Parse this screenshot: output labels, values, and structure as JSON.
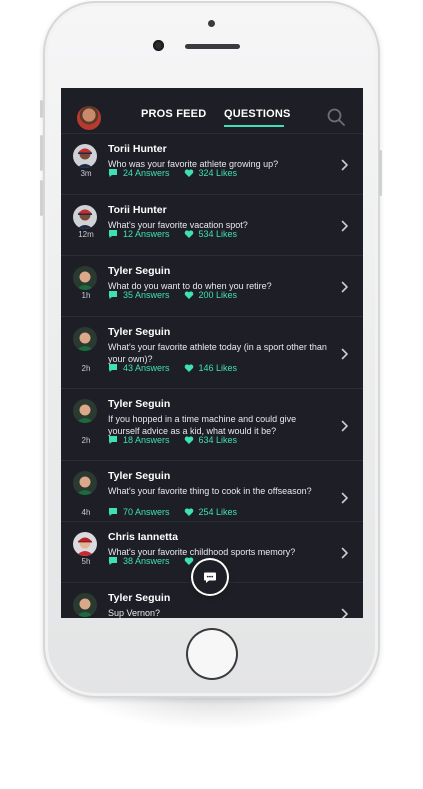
{
  "header": {
    "tabs": [
      {
        "label": "PROS FEED",
        "active": false
      },
      {
        "label": "QUESTIONS",
        "active": true
      }
    ]
  },
  "colors": {
    "accent": "#3ee0b5",
    "background": "#1e1f26",
    "divider": "#2b2c35"
  },
  "questions": [
    {
      "name": "Torii Hunter",
      "question": "Who was your favorite athlete growing up?",
      "time": "3m",
      "answers": "24 Answers",
      "likes": "324 Likes",
      "avatar": "torii"
    },
    {
      "name": "Torii Hunter",
      "question": "What's your favorite vacation spot?",
      "time": "12m",
      "answers": "12 Answers",
      "likes": "534 Likes",
      "avatar": "torii"
    },
    {
      "name": "Tyler Seguin",
      "question": "What do you want to do when you retire?",
      "time": "1h",
      "answers": "35 Answers",
      "likes": "200 Likes",
      "avatar": "tyler"
    },
    {
      "name": "Tyler Seguin",
      "question": "What's your favorite athlete today (in a sport other than your own)?",
      "time": "2h",
      "answers": "43 Answers",
      "likes": "146 Likes",
      "avatar": "tyler"
    },
    {
      "name": "Tyler Seguin",
      "question": "If you hopped in a time machine and could give yourself advice as a kid, what would it be?",
      "time": "2h",
      "answers": "18 Answers",
      "likes": "634 Likes",
      "avatar": "tyler"
    },
    {
      "name": "Tyler Seguin",
      "question": "What's your favorite thing to cook in the offseason?",
      "time": "4h",
      "answers": "70 Answers",
      "likes": "254 Likes",
      "avatar": "tyler"
    },
    {
      "name": "Chris Iannetta",
      "question": "What's your favorite childhood sports memory?",
      "time": "5h",
      "answers": "38 Answers",
      "likes": "",
      "avatar": "chris"
    },
    {
      "name": "Tyler Seguin",
      "question": "Sup Vernon?",
      "time": "",
      "answers": "",
      "likes": "",
      "avatar": "tyler"
    }
  ],
  "icons": {
    "search": "search-icon",
    "compose": "compose-message-icon",
    "answers": "chat-bubble-icon",
    "likes": "heart-icon",
    "chevron": "chevron-right-icon"
  }
}
